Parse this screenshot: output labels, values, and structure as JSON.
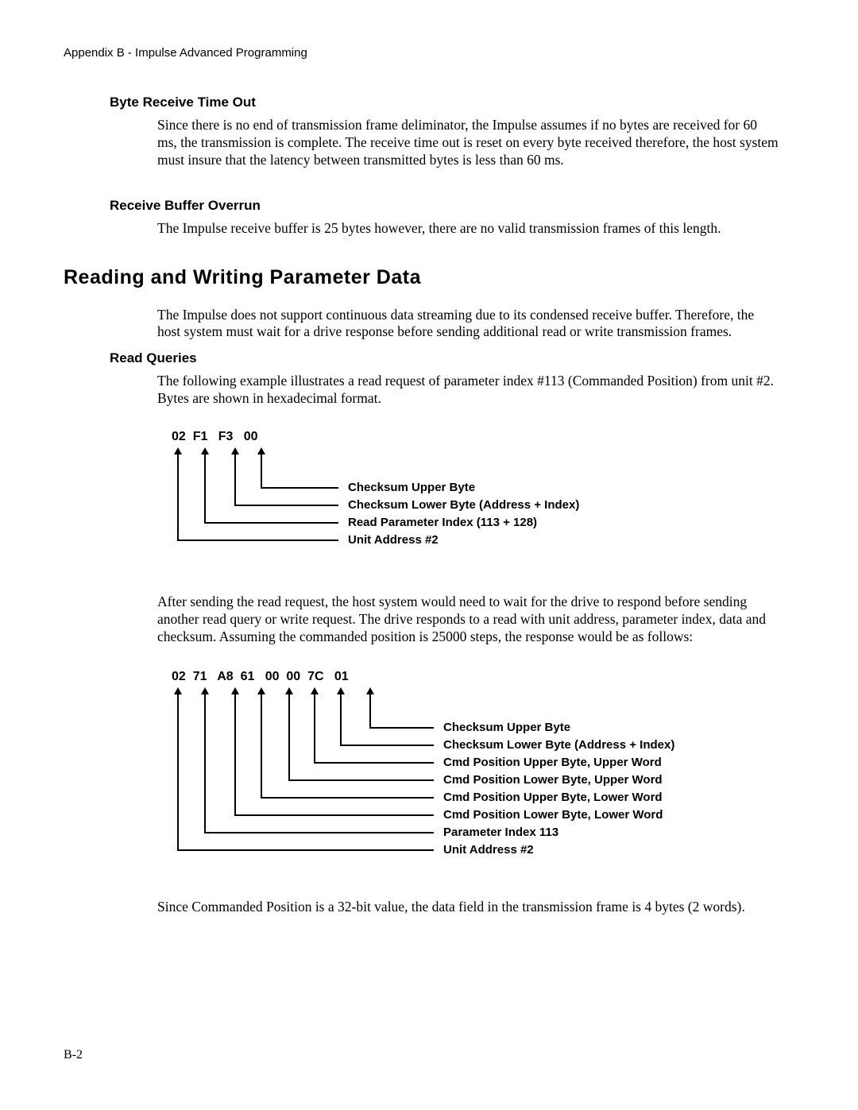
{
  "header": "Appendix B - Impulse Advanced Programming",
  "sections": {
    "byteReceive": {
      "title": "Byte Receive Time Out",
      "para": "Since there is no end of transmission frame deliminator, the Impulse assumes if no bytes are received for 60 ms, the transmission is complete.  The receive time out is reset on every byte received therefore, the host system must insure that the latency between transmitted bytes is less than 60 ms."
    },
    "receiveBuffer": {
      "title": "Receive Buffer Overrun",
      "para": "The Impulse receive buffer is 25 bytes however, there are no valid transmission frames of this length."
    },
    "mainTitle": "Reading and Writing Parameter Data",
    "intro": "The Impulse does not support continuous data streaming due to its condensed receive buffer.  Therefore, the host system must wait for a drive response before sending additional read or write transmission frames.",
    "readQueries": {
      "title": "Read Queries",
      "para1": "The following example illustrates a read request of parameter index #113 (Commanded Position) from unit #2.  Bytes are shown in hexadecimal format."
    },
    "diagram1": {
      "bytes": "02  F1   F3   00",
      "labels": {
        "l0": "Checksum Upper Byte",
        "l1": "Checksum Lower Byte (Address + Index)",
        "l2": "Read Parameter Index (113 + 128)",
        "l3": "Unit Address #2"
      }
    },
    "afterDiagram1": "After sending the read request, the host system would need to wait for the drive to respond before sending another read query or write request.  The drive responds to a read with unit address, parameter index, data and checksum.  Assuming the commanded position is 25000 steps, the response would be as follows:",
    "diagram2": {
      "bytes": "02  71   A8  61   00  00  7C   01",
      "labels": {
        "l0": "Checksum Upper Byte",
        "l1": "Checksum Lower Byte (Address + Index)",
        "l2": "Cmd Position Upper Byte, Upper Word",
        "l3": "Cmd Position Lower Byte, Upper Word",
        "l4": "Cmd Position Upper Byte, Lower Word",
        "l5": "Cmd Position Lower Byte, Lower Word",
        "l6": "Parameter Index 113",
        "l7": "Unit Address #2"
      }
    },
    "afterDiagram2": "Since Commanded Position is a 32-bit value, the data field in the transmission frame is 4 bytes (2 words).",
    "footer": "B-2"
  }
}
